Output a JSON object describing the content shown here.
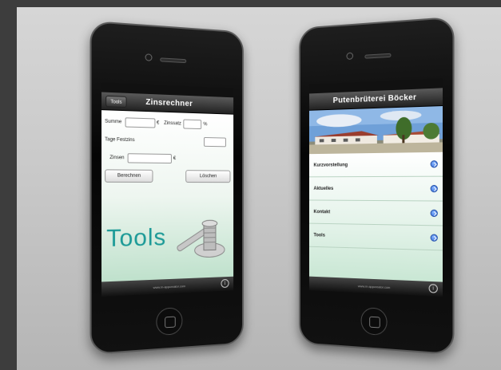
{
  "left_phone": {
    "nav_title": "Zinsrechner",
    "back_label": "Tools",
    "rows": [
      {
        "label": "Summe",
        "unit": "€",
        "label2": "Zinssatz",
        "unit2": "%"
      },
      {
        "label": "Tage Festzins",
        "unit": ""
      },
      {
        "label": "Zinsen",
        "unit": "€"
      }
    ],
    "buttons": {
      "calculate": "Berechnen",
      "clear": "Löschen"
    },
    "tools_label": "Tools",
    "footer_url": "www.m-appcreator.com",
    "info_glyph": "i"
  },
  "right_phone": {
    "nav_title": "Putenbrüterei Böcker",
    "menu_items": [
      {
        "label": "Kurzvorstellung"
      },
      {
        "label": "Aktuelles"
      },
      {
        "label": "Kontakt"
      },
      {
        "label": "Tools"
      }
    ],
    "footer_url": "www.m-appcreator.com",
    "info_glyph": "i"
  }
}
